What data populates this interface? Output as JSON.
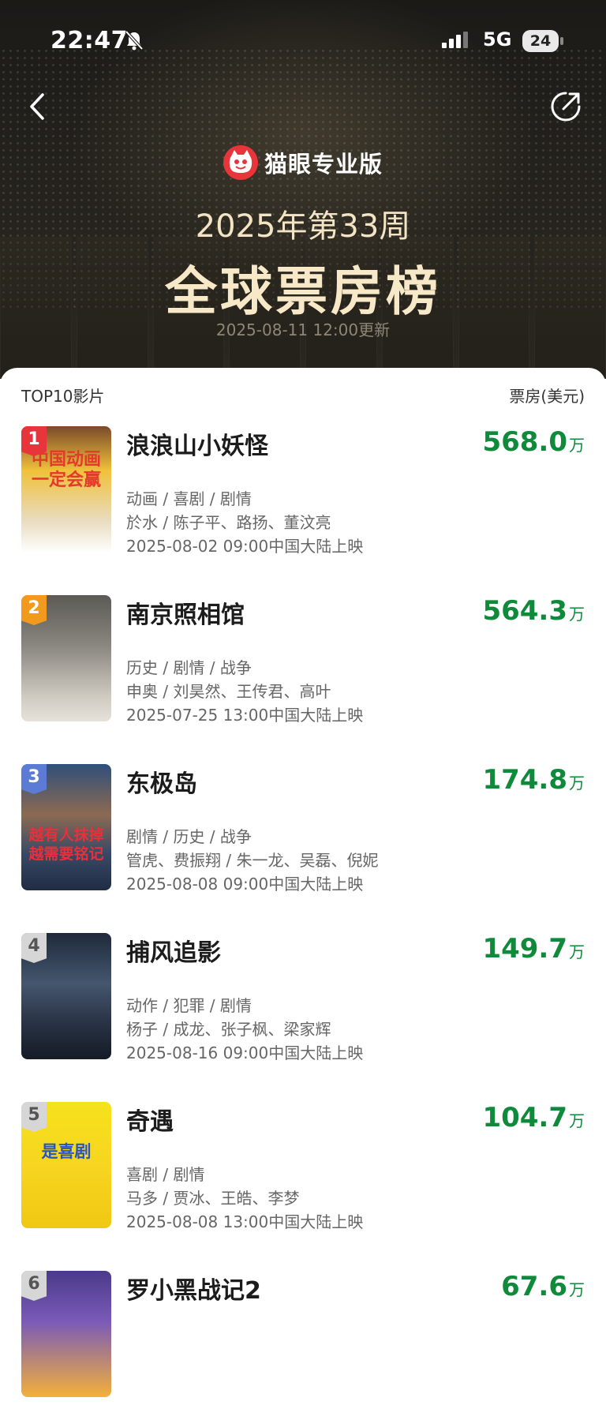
{
  "status_bar": {
    "time": "22:47",
    "network": "5G",
    "battery": "24"
  },
  "brand": {
    "name": "猫眼专业版"
  },
  "header": {
    "week_label": "2025年第33周",
    "title": "全球票房榜",
    "update_text": "2025-08-11 12:00更新"
  },
  "list": {
    "header_left": "TOP10影片",
    "header_right": "票房(美元)",
    "unit": "万",
    "items": [
      {
        "rank": "1",
        "title": "浪浪山小妖怪",
        "box": "568.0",
        "genres": "动画 / 喜剧 / 剧情",
        "people": "於水 / 陈子平、路扬、董汶亮",
        "release": "2025-08-02 09:00中国大陆上映",
        "badge_color": "#e8353c"
      },
      {
        "rank": "2",
        "title": "南京照相馆",
        "box": "564.3",
        "genres": "历史 / 剧情 / 战争",
        "people": "申奥 / 刘昊然、王传君、高叶",
        "release": "2025-07-25 13:00中国大陆上映",
        "badge_color": "#f29a1d"
      },
      {
        "rank": "3",
        "title": "东极岛",
        "box": "174.8",
        "genres": "剧情 / 历史 / 战争",
        "people": "管虎、费振翔 / 朱一龙、吴磊、倪妮",
        "release": "2025-08-08 09:00中国大陆上映",
        "badge_color": "#5b7bd5"
      },
      {
        "rank": "4",
        "title": "捕风追影",
        "box": "149.7",
        "genres": "动作 / 犯罪 / 剧情",
        "people": "杨子 / 成龙、张子枫、梁家辉",
        "release": "2025-08-16 09:00中国大陆上映",
        "badge_color": "#cfcfcf"
      },
      {
        "rank": "5",
        "title": "奇遇",
        "box": "104.7",
        "genres": "喜剧 / 剧情",
        "people": "马多 / 贾冰、王皓、李梦",
        "release": "2025-08-08 13:00中国大陆上映",
        "badge_color": "#cfcfcf"
      },
      {
        "rank": "6",
        "title": "罗小黑战记2",
        "box": "67.6",
        "genres": "",
        "people": "",
        "release": "",
        "badge_color": "#cfcfcf"
      }
    ]
  },
  "posters": {
    "p1": "中国动画一定会赢",
    "p3": "越有人抹掉越需要铭记",
    "p5": "是喜剧"
  },
  "icons": {
    "back": "chevron-left-icon",
    "share": "share-icon",
    "logo": "cat-logo-icon"
  },
  "colors": {
    "accent_green": "#0f8a3a",
    "brand_red": "#e8353c"
  }
}
